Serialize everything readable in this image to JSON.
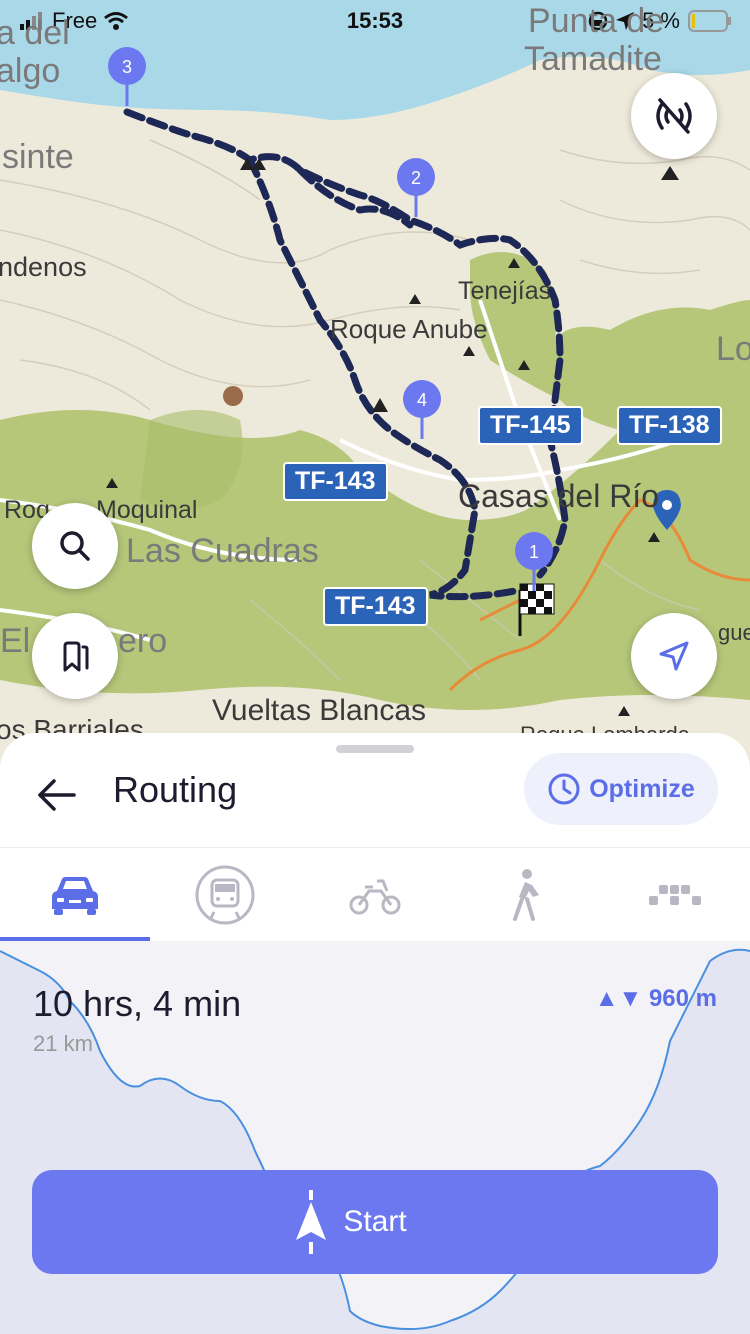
{
  "status_bar": {
    "carrier": "Free",
    "time": "15:53",
    "battery": "5 %"
  },
  "map": {
    "place_labels": {
      "punta": "Punta de",
      "tamadite": "Tamadite",
      "a_del": "a del",
      "algo": "algo",
      "sinte": "sinte",
      "ndenos": "ndenos",
      "tenejias": "Tenejías",
      "roque_anube": "Roque Anube",
      "lo": "Lo",
      "casas": "Casas del Río",
      "roq": "Roq",
      "moquinal": "Moquinal",
      "las_cuadras": "Las Cuadras",
      "el": "El",
      "ero": "ero",
      "vueltas": "Vueltas Blancas",
      "os_barriales": "os Barriales",
      "roque_lombarda": "Roque Lombarda",
      "gue": "gue"
    },
    "roads": {
      "tf145": "TF-145",
      "tf138": "TF-138",
      "tf143_a": "TF-143",
      "tf143_b": "TF-143"
    },
    "waypoints": [
      "1",
      "2",
      "3",
      "4"
    ],
    "icons": {
      "layers_toggle": "no-signal-icon",
      "search": "search-icon",
      "bookmarks": "bookmarks-icon",
      "location": "navigate-arrow-icon"
    }
  },
  "sheet": {
    "title": "Routing",
    "optimize_label": "Optimize",
    "modes": [
      "car",
      "transit",
      "bike",
      "walk",
      "more"
    ],
    "active_mode": "car",
    "duration": "10 hrs, 4 min",
    "distance": "21 km",
    "elevation": "960 m",
    "start_label": "Start"
  },
  "colors": {
    "accent": "#5b6ee8",
    "start_button": "#6b78f0",
    "route": "#1e2856",
    "pin": "#6b78f0",
    "sea": "#a9d8e8",
    "forest": "#b6c77a",
    "road_badge": "#2b63b8"
  }
}
